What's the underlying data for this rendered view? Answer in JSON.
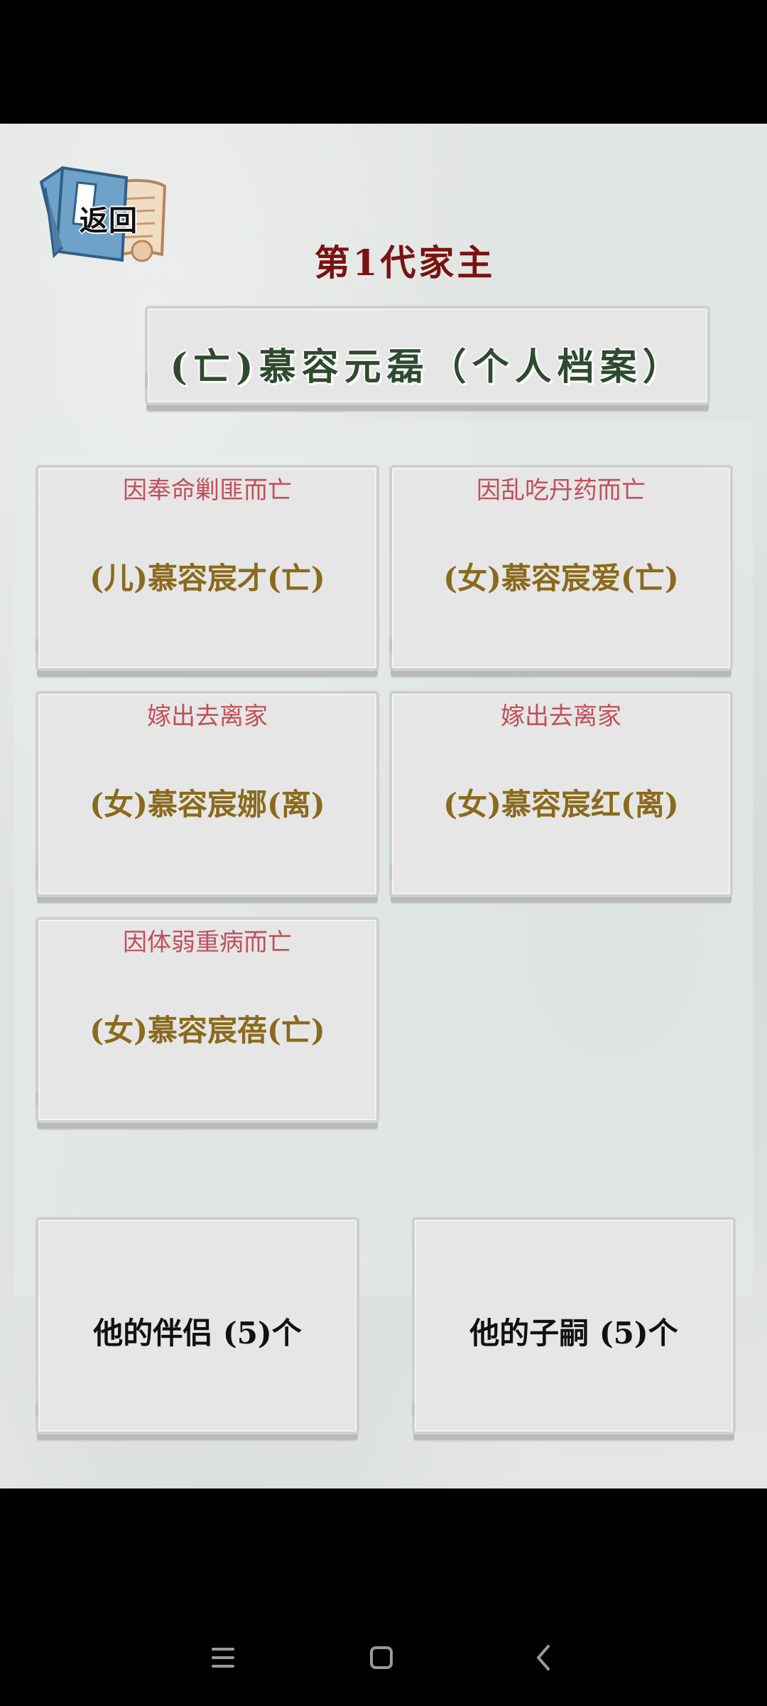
{
  "header": {
    "back_label": "返回",
    "generation_title": "第1代家主",
    "profile_title": "(亡)慕容元磊（个人档案）"
  },
  "children": [
    {
      "reason": "因奉命剿匪而亡",
      "name": "(儿)慕容宸才(亡)"
    },
    {
      "reason": "因乱吃丹药而亡",
      "name": "(女)慕容宸爱(亡)"
    },
    {
      "reason": "嫁出去离家",
      "name": "(女)慕容宸娜(离)"
    },
    {
      "reason": "嫁出去离家",
      "name": "(女)慕容宸红(离)"
    },
    {
      "reason": "因体弱重病而亡",
      "name": "(女)慕容宸蓓(亡)"
    }
  ],
  "footer_buttons": {
    "partners": "他的伴侣 (5)个",
    "heirs": "他的子嗣 (5)个"
  },
  "colors": {
    "title_red": "#7a1212",
    "profile_green": "#2f4b2f",
    "reason_red": "#c0505a",
    "name_gold": "#8a6a1c"
  },
  "icons": {
    "back": "book-scroll-icon",
    "nav_menu": "menu-icon",
    "nav_home": "home-square-icon",
    "nav_back": "chevron-left-icon"
  }
}
